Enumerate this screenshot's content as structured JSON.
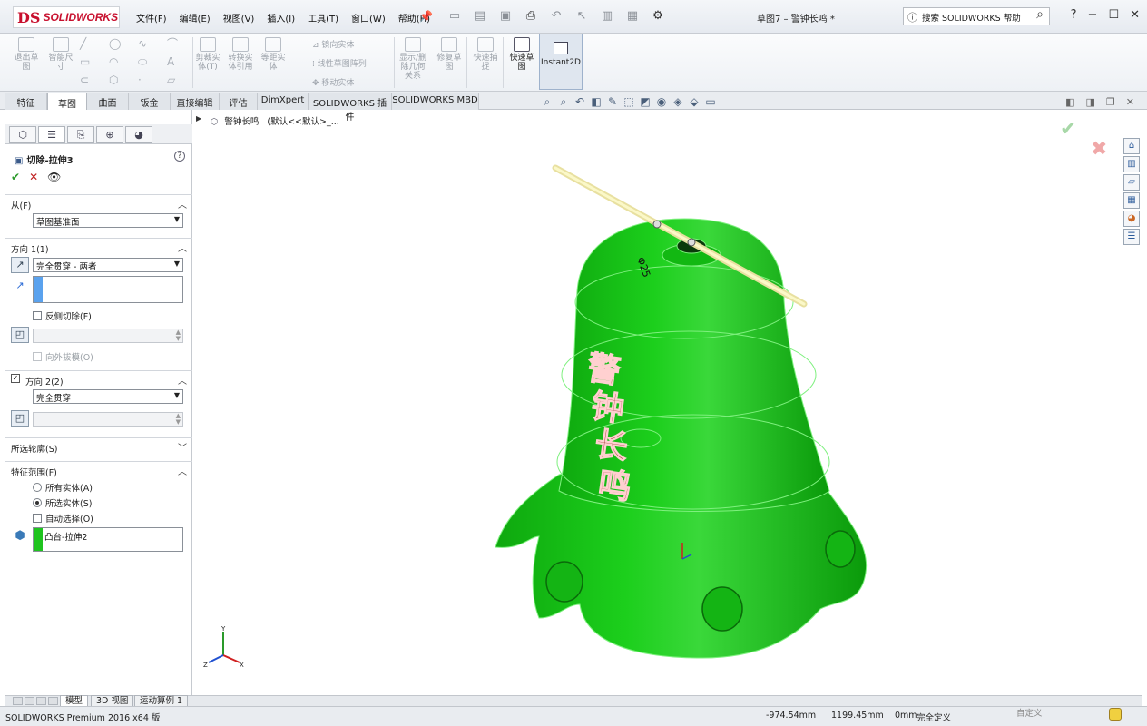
{
  "app": {
    "logo_ds": "DS",
    "logo_text": "SOLIDWORKS",
    "menu": [
      "文件(F)",
      "编辑(E)",
      "视图(V)",
      "插入(I)",
      "工具(T)",
      "窗口(W)",
      "帮助(H)"
    ],
    "doc_title": "草图7 – 警钟长鸣 *",
    "search_placeholder": "搜索 SOLIDWORKS 帮助",
    "help_btn": "?"
  },
  "ribbon": {
    "exit_sketch": "退出草图",
    "smart_dim": "智能尺寸",
    "trim": "剪裁实体(T)",
    "convert": "转换实体引用",
    "offset": "等距实体",
    "mirror": "镜向实体",
    "linear_pattern": "线性草图阵列",
    "move": "移动实体",
    "display_delete": "显示/删除几何关系",
    "repair": "修复草图",
    "quick_snap": "快速捕捉",
    "rapid_sketch": "快速草图",
    "instant2d": "Instant2D"
  },
  "tabs": [
    "特征",
    "草图",
    "曲面",
    "钣金",
    "直接编辑",
    "评估",
    "DimXpert",
    "SOLIDWORKS 插件",
    "SOLIDWORKS MBD"
  ],
  "active_tab": "草图",
  "tree": {
    "root": "警钟长鸣",
    "config": "(默认<<默认>_..."
  },
  "feature_panel": {
    "title": "切除-拉伸3",
    "from_label": "从(F)",
    "from_value": "草图基准面",
    "dir1_label": "方向 1(1)",
    "dir1_value": "完全贯穿 - 两者",
    "flip_side": "反侧切除(F)",
    "draft_outward": "向外拔模(O)",
    "dir2_label": "方向 2(2)",
    "dir2_value": "完全贯穿",
    "selected_contours": "所选轮廓(S)",
    "feature_scope": "特征范围(F)",
    "all_bodies": "所有实体(A)",
    "selected_bodies": "所选实体(S)",
    "auto_select": "自动选择(O)",
    "body_item": "凸台-拉伸2"
  },
  "model": {
    "engraving": [
      "警",
      "钟",
      "长",
      "鸣"
    ],
    "dim_label": "Φ25"
  },
  "bottom_tabs": [
    "模型",
    "3D 视图",
    "运动算例 1"
  ],
  "status": {
    "product": "SOLIDWORKS Premium 2016 x64 版",
    "x": "-974.54mm",
    "y": "1199.45mm",
    "z": "0mm",
    "state": "完全定义",
    "custom": "自定义"
  },
  "colors": {
    "body_green": "#1fc41f",
    "rod": "#f2ec9a",
    "text_red": "#b04040"
  }
}
